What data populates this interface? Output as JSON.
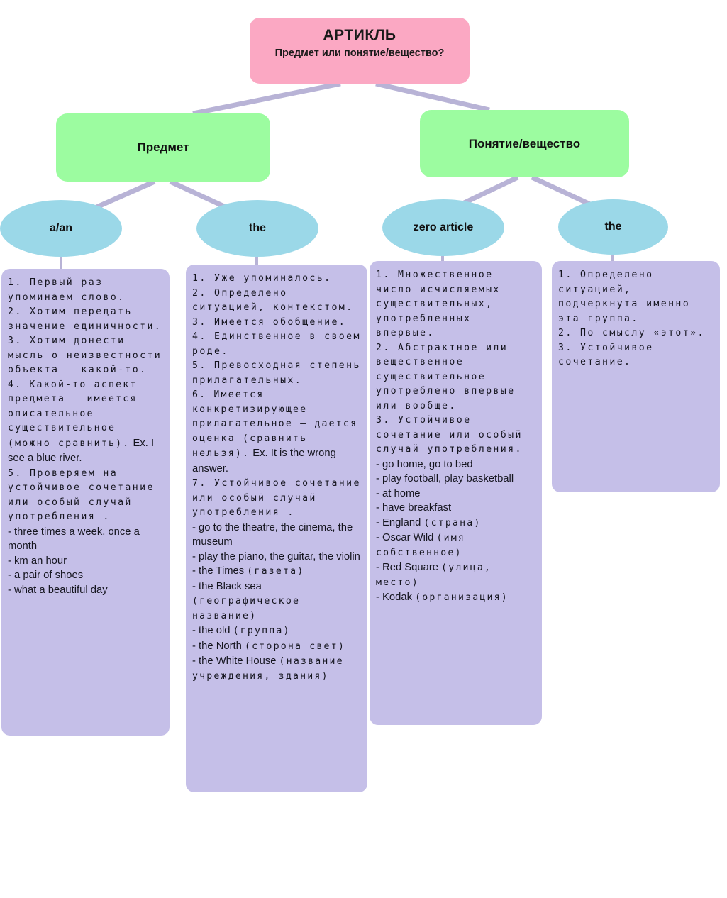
{
  "diagram": {
    "title": "АРТИКЛЬ",
    "subtitle": "Предмет или понятие/вещество?",
    "colors": {
      "root": "#fba8c3",
      "branch": "#9cfca0",
      "leaf": "#9bd8e8",
      "detail": "#c5bfe8",
      "connector": "#b8b3d6"
    },
    "branches": [
      {
        "label": "Предмет"
      },
      {
        "label": "Понятие/вещество"
      }
    ],
    "articles": [
      {
        "label": "a/an"
      },
      {
        "label": "the"
      },
      {
        "label": "zero article"
      },
      {
        "label": "the"
      }
    ],
    "details": [
      {
        "for": "a/an",
        "lines": [
          {
            "script": "ru",
            "text": "1. Первый раз упоминаем слово."
          },
          {
            "script": "ru",
            "text": "2. Хотим передать значение единичности."
          },
          {
            "script": "ru",
            "text": "3. Хотим донести мысль о неизвестности объекта – какой-то."
          },
          {
            "script": "mix",
            "ru": "4. Какой-то аспект предмета – имеется описательное существительное (можно сравнить).",
            "en": " Ex. I see a blue river."
          },
          {
            "script": "ru",
            "text": "5. Проверяем на устойчивое сочетание или особый случай употребления ."
          },
          {
            "script": "en",
            "text": "- three times a week, once a month"
          },
          {
            "script": "en",
            "text": "- km an hour"
          },
          {
            "script": "en",
            "text": "- a pair of shoes"
          },
          {
            "script": "en",
            "text": "- what a beautiful day"
          }
        ]
      },
      {
        "for": "the",
        "lines": [
          {
            "script": "ru",
            "text": "1. Уже упоминалось."
          },
          {
            "script": "ru",
            "text": "2. Определено ситуацией, контекстом."
          },
          {
            "script": "ru",
            "text": "3. Имеется обобщение."
          },
          {
            "script": "ru",
            "text": "4. Единственное в своем роде."
          },
          {
            "script": "ru",
            "text": "5. Превосходная степень прилагательных."
          },
          {
            "script": "mix",
            "ru": "6. Имеется конкретизирующее прилагательное – дается оценка (сравнить нельзя).",
            "en": " Ex. It is the wrong answer."
          },
          {
            "script": "ru",
            "text": "7. Устойчивое сочетание или особый случай употребления ."
          },
          {
            "script": "en",
            "text": "- go to the theatre, the cinema, the museum"
          },
          {
            "script": "en",
            "text": "- play the piano, the guitar, the violin"
          },
          {
            "script": "mix",
            "en": "- the Times ",
            "ru": "(газета)"
          },
          {
            "script": "mix",
            "en": "- the Black sea ",
            "ru": "(географическое название)"
          },
          {
            "script": "mix",
            "en": "- the old ",
            "ru": "(группа)"
          },
          {
            "script": "mix",
            "en": "- the North ",
            "ru": "(сторона свет)"
          },
          {
            "script": "mix",
            "en": "- the White House ",
            "ru": "(название учреждения, здания)"
          }
        ]
      },
      {
        "for": "zero article",
        "lines": [
          {
            "script": "ru",
            "text": "1. Множественное число исчисляемых существительных, употребленных впервые."
          },
          {
            "script": "ru",
            "text": "2. Абстрактное или вещественное существительное употреблено впервые или вообще."
          },
          {
            "script": "ru",
            "text": "3. Устойчивое сочетание или особый случай употребления."
          },
          {
            "script": "en",
            "text": "- go home, go to bed"
          },
          {
            "script": "en",
            "text": "- play football, play basketball"
          },
          {
            "script": "en",
            "text": "- at home"
          },
          {
            "script": "en",
            "text": "- have breakfast"
          },
          {
            "script": "mix",
            "en": "- England ",
            "ru": "(страна)"
          },
          {
            "script": "mix",
            "en": "- Oscar Wild ",
            "ru": "(имя собственное)"
          },
          {
            "script": "mix",
            "en": "- Red Square ",
            "ru": "(улица, место)"
          },
          {
            "script": "mix",
            "en": "- Kodak ",
            "ru": "(организация)"
          }
        ]
      },
      {
        "for": "the",
        "lines": [
          {
            "script": "ru",
            "text": "1. Определено ситуацией, подчеркнута именно эта группа."
          },
          {
            "script": "ru",
            "text": "2. По смыслу «этот»."
          },
          {
            "script": "ru",
            "text": "3. Устойчивое сочетание."
          }
        ]
      }
    ]
  }
}
